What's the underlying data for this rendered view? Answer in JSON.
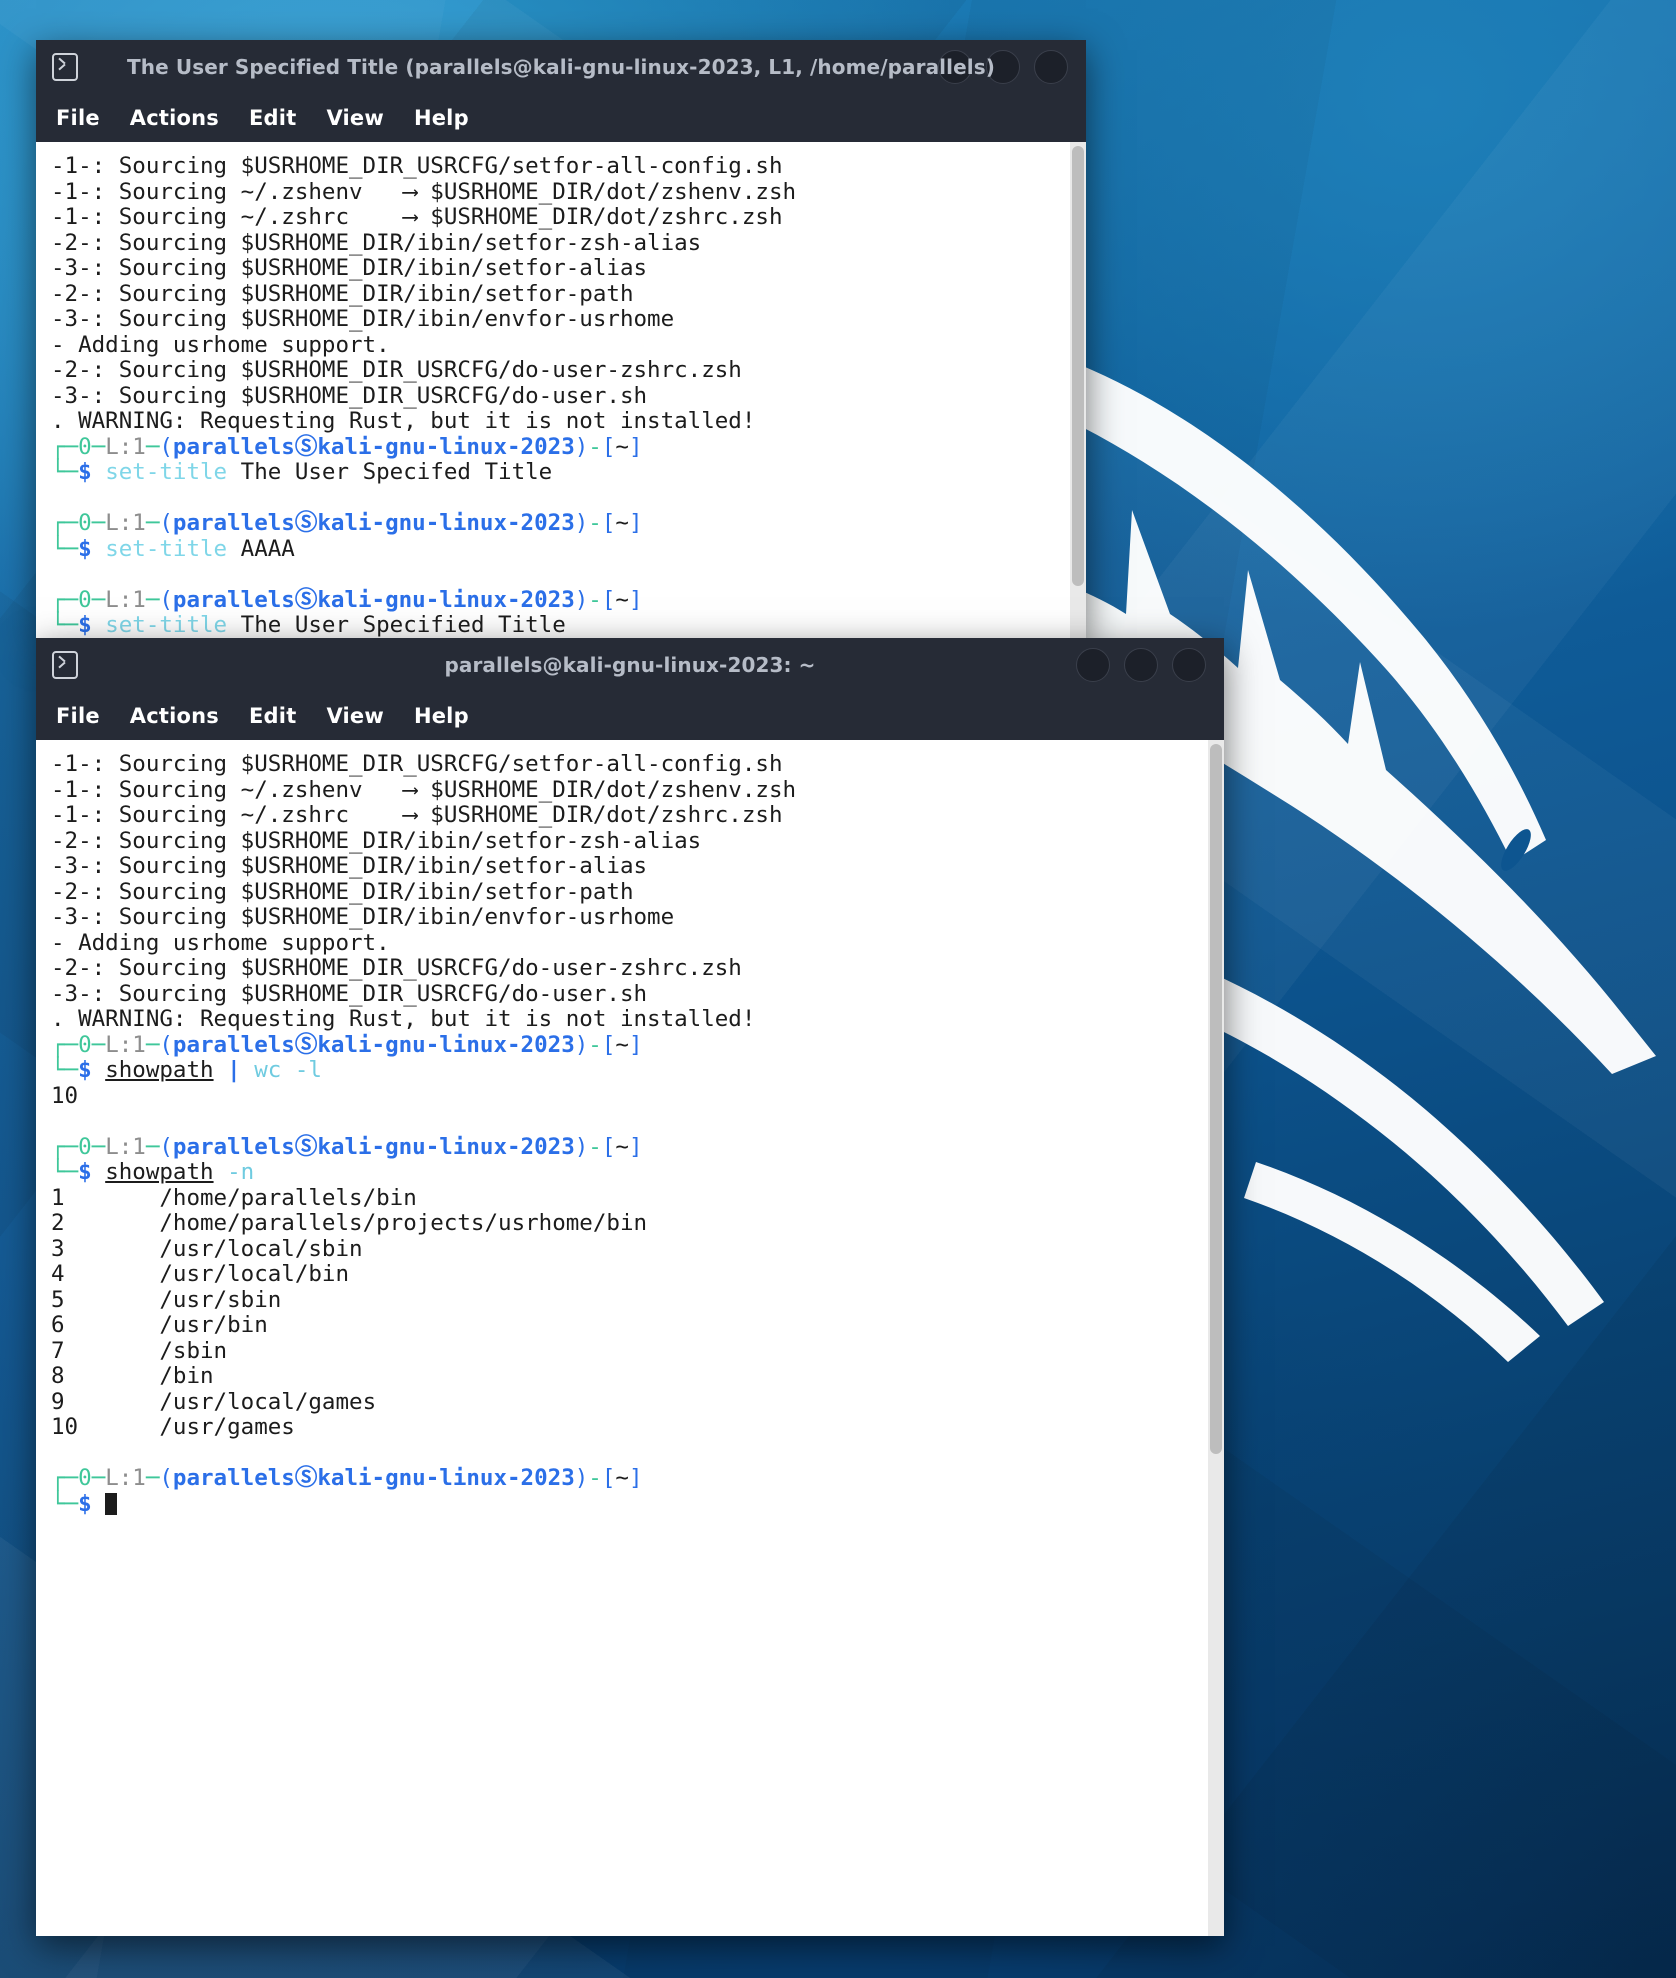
{
  "desktop": {
    "wallpaper_name": "kali-dragon-wallpaper",
    "bg_color": "#0d5590",
    "dragon_color": "#ffffff"
  },
  "windows": [
    {
      "id": "window-top",
      "title": "The User Specified Title (parallels@kali-gnu-linux-2023, L1, /home/parallels)",
      "icon": "terminal-icon",
      "menu": [
        "File",
        "Actions",
        "Edit",
        "View",
        "Help"
      ],
      "buttons": [
        "minimize-button",
        "maximize-button",
        "close-button"
      ],
      "content": "-1-: Sourcing $USRHOME_DIR_USRCFG/setfor-all-config.sh\n-1-: Sourcing ~/.zshenv   ⟶ $USRHOME_DIR/dot/zshenv.zsh\n-1-: Sourcing ~/.zshrc    ⟶ $USRHOME_DIR/dot/zshrc.zsh\n-2-: Sourcing $USRHOME_DIR/ibin/setfor-zsh-alias\n-3-: Sourcing $USRHOME_DIR/ibin/setfor-alias\n-2-: Sourcing $USRHOME_DIR/ibin/setfor-path\n-3-: Sourcing $USRHOME_DIR/ibin/envfor-usrhome\n- Adding usrhome support.\n-2-: Sourcing $USRHOME_DIR_USRCFG/do-user-zshrc.zsh\n-3-: Sourcing $USRHOME_DIR_USRCFG/do-user.sh\n. WARNING: Requesting Rust, but it is not installed!",
      "prompts": [
        {
          "exit": "0",
          "level": "L:1",
          "user": "parallels",
          "host": "kali-gnu-linux-2023",
          "cwd": "~",
          "command": "set-title",
          "args": "The User Specifed Title"
        },
        {
          "exit": "0",
          "level": "L:1",
          "user": "parallels",
          "host": "kali-gnu-linux-2023",
          "cwd": "~",
          "command": "set-title",
          "args": "AAAA"
        },
        {
          "exit": "0",
          "level": "L:1",
          "user": "parallels",
          "host": "kali-gnu-linux-2023",
          "cwd": "~",
          "command": "set-title",
          "args": "The User Specified Title"
        }
      ]
    },
    {
      "id": "window-bottom",
      "title": "parallels@kali-gnu-linux-2023: ~",
      "icon": "terminal-icon",
      "menu": [
        "File",
        "Actions",
        "Edit",
        "View",
        "Help"
      ],
      "buttons": [
        "minimize-button",
        "maximize-button",
        "close-button"
      ],
      "content": "-1-: Sourcing $USRHOME_DIR_USRCFG/setfor-all-config.sh\n-1-: Sourcing ~/.zshenv   ⟶ $USRHOME_DIR/dot/zshenv.zsh\n-1-: Sourcing ~/.zshrc    ⟶ $USRHOME_DIR/dot/zshrc.zsh\n-2-: Sourcing $USRHOME_DIR/ibin/setfor-zsh-alias\n-3-: Sourcing $USRHOME_DIR/ibin/setfor-alias\n-2-: Sourcing $USRHOME_DIR/ibin/setfor-path\n-3-: Sourcing $USRHOME_DIR/ibin/envfor-usrhome\n- Adding usrhome support.\n-2-: Sourcing $USRHOME_DIR_USRCFG/do-user-zshrc.zsh\n-3-: Sourcing $USRHOME_DIR_USRCFG/do-user.sh\n. WARNING: Requesting Rust, but it is not installed!",
      "cmd1": {
        "name": "showpath",
        "pipe": "|",
        "rest": "wc -l",
        "output": "10"
      },
      "cmd2": {
        "name": "showpath",
        "flag": "-n"
      },
      "path_list": [
        {
          "n": "1",
          "path": "/home/parallels/bin"
        },
        {
          "n": "2",
          "path": "/home/parallels/projects/usrhome/bin"
        },
        {
          "n": "3",
          "path": "/usr/local/sbin"
        },
        {
          "n": "4",
          "path": "/usr/local/bin"
        },
        {
          "n": "5",
          "path": "/usr/sbin"
        },
        {
          "n": "6",
          "path": "/usr/bin"
        },
        {
          "n": "7",
          "path": "/sbin"
        },
        {
          "n": "8",
          "path": "/bin"
        },
        {
          "n": "9",
          "path": "/usr/local/games"
        },
        {
          "n": "10",
          "path": "/usr/games"
        }
      ],
      "prompt_meta": {
        "exit": "0",
        "level": "L:1",
        "user": "parallels",
        "host": "kali-gnu-linux-2023",
        "cwd": "~"
      }
    }
  ],
  "prompt_glyphs": {
    "top_corner": "┌─",
    "bottom_corner": "└─",
    "dash": "─",
    "at": "Ⓤ",
    "dollar": "$",
    "open_paren": "(",
    "close_paren": ")",
    "open_bracket": "[",
    "close_bracket": "]",
    "arrow": "⟶"
  },
  "colors": {
    "prompt_green": "#3fc79a",
    "prompt_blue": "#2b6fe8",
    "command_cyan": "#7fd6e8",
    "text_dark": "#1c1c1c",
    "titlebar": "#262b36",
    "title_text": "#b6bcc7",
    "menu_text": "#ffffff",
    "terminal_bg": "#ffffff"
  }
}
